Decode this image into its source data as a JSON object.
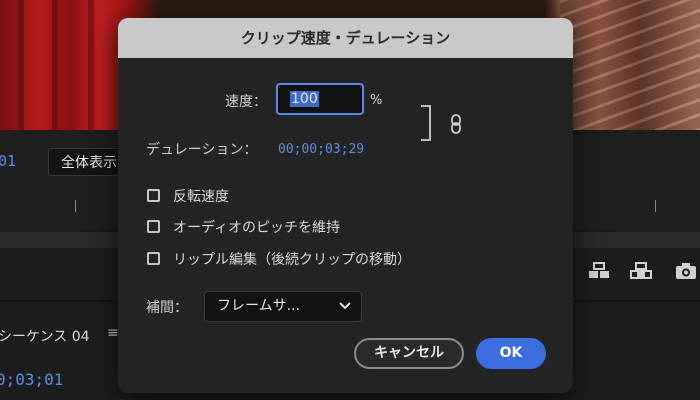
{
  "background": {
    "monitor_timecode": "01",
    "fit_dropdown": "全体表示",
    "sequence_name": "シーケンス 04",
    "sequence_menu_icon": "hamburger-icon",
    "timeline_timecode": "0;03;01",
    "icons": [
      "insert-icon",
      "overwrite-icon",
      "camera-icon"
    ]
  },
  "dialog": {
    "title": "クリップ速度・デュレーション",
    "speed": {
      "label": "速度：",
      "value": "100",
      "unit": "%"
    },
    "link_icon": "chain-link-icon",
    "duration": {
      "label": "デュレーション：",
      "value": "00;00;03;29"
    },
    "options": [
      {
        "label": "反転速度",
        "checked": false
      },
      {
        "label": "オーディオのピッチを維持",
        "checked": false
      },
      {
        "label": "リップル編集（後続クリップの移動）",
        "checked": false
      }
    ],
    "interpolation": {
      "label": "補間：",
      "value": "フレームサ..."
    },
    "buttons": {
      "cancel": "キャンセル",
      "ok": "OK"
    },
    "colors": {
      "accent": "#3b6fe0",
      "timecode": "#5a8ee6"
    }
  }
}
